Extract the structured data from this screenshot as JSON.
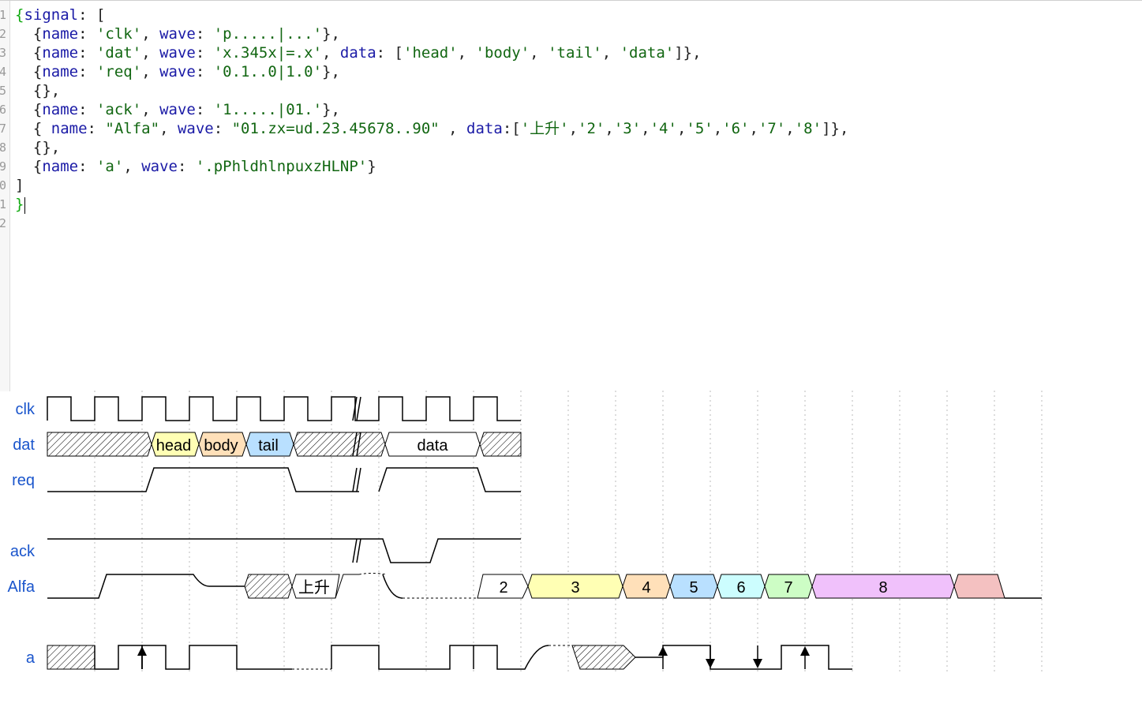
{
  "editor": {
    "line_numbers": [
      "1",
      "2",
      "3",
      "4",
      "5",
      "6",
      "7",
      "8",
      "9",
      "0",
      "1",
      "2"
    ],
    "code_lines": [
      [
        {
          "t": "{",
          "c": "br"
        },
        {
          "t": "signal",
          "c": "k"
        },
        {
          "t": ": [",
          "c": "p"
        }
      ],
      [
        {
          "t": "  {",
          "c": "p"
        },
        {
          "t": "name",
          "c": "k"
        },
        {
          "t": ": ",
          "c": "p"
        },
        {
          "t": "'clk'",
          "c": "s"
        },
        {
          "t": ", ",
          "c": "p"
        },
        {
          "t": "wave",
          "c": "k"
        },
        {
          "t": ": ",
          "c": "p"
        },
        {
          "t": "'p.....|...'",
          "c": "s"
        },
        {
          "t": "},",
          "c": "p"
        }
      ],
      [
        {
          "t": "  {",
          "c": "p"
        },
        {
          "t": "name",
          "c": "k"
        },
        {
          "t": ": ",
          "c": "p"
        },
        {
          "t": "'dat'",
          "c": "s"
        },
        {
          "t": ", ",
          "c": "p"
        },
        {
          "t": "wave",
          "c": "k"
        },
        {
          "t": ": ",
          "c": "p"
        },
        {
          "t": "'x.345x|=.x'",
          "c": "s"
        },
        {
          "t": ", ",
          "c": "p"
        },
        {
          "t": "data",
          "c": "k"
        },
        {
          "t": ": [",
          "c": "p"
        },
        {
          "t": "'head'",
          "c": "s"
        },
        {
          "t": ", ",
          "c": "p"
        },
        {
          "t": "'body'",
          "c": "s"
        },
        {
          "t": ", ",
          "c": "p"
        },
        {
          "t": "'tail'",
          "c": "s"
        },
        {
          "t": ", ",
          "c": "p"
        },
        {
          "t": "'data'",
          "c": "s"
        },
        {
          "t": "]},",
          "c": "p"
        }
      ],
      [
        {
          "t": "  {",
          "c": "p"
        },
        {
          "t": "name",
          "c": "k"
        },
        {
          "t": ": ",
          "c": "p"
        },
        {
          "t": "'req'",
          "c": "s"
        },
        {
          "t": ", ",
          "c": "p"
        },
        {
          "t": "wave",
          "c": "k"
        },
        {
          "t": ": ",
          "c": "p"
        },
        {
          "t": "'0.1..0|1.0'",
          "c": "s"
        },
        {
          "t": "},",
          "c": "p"
        }
      ],
      [
        {
          "t": "  {},",
          "c": "p"
        }
      ],
      [
        {
          "t": "  {",
          "c": "p"
        },
        {
          "t": "name",
          "c": "k"
        },
        {
          "t": ": ",
          "c": "p"
        },
        {
          "t": "'ack'",
          "c": "s"
        },
        {
          "t": ", ",
          "c": "p"
        },
        {
          "t": "wave",
          "c": "k"
        },
        {
          "t": ": ",
          "c": "p"
        },
        {
          "t": "'1.....|01.'",
          "c": "s"
        },
        {
          "t": "},",
          "c": "p"
        }
      ],
      [
        {
          "t": "  { ",
          "c": "p"
        },
        {
          "t": "name",
          "c": "k"
        },
        {
          "t": ": ",
          "c": "p"
        },
        {
          "t": "\"Alfa\"",
          "c": "s"
        },
        {
          "t": ", ",
          "c": "p"
        },
        {
          "t": "wave",
          "c": "k"
        },
        {
          "t": ": ",
          "c": "p"
        },
        {
          "t": "\"01.zx=ud.23.45678..90\"",
          "c": "s"
        },
        {
          "t": " , ",
          "c": "p"
        },
        {
          "t": "data",
          "c": "k"
        },
        {
          "t": ":[",
          "c": "p"
        },
        {
          "t": "'上升'",
          "c": "s"
        },
        {
          "t": ",",
          "c": "p"
        },
        {
          "t": "'2'",
          "c": "s"
        },
        {
          "t": ",",
          "c": "p"
        },
        {
          "t": "'3'",
          "c": "s"
        },
        {
          "t": ",",
          "c": "p"
        },
        {
          "t": "'4'",
          "c": "s"
        },
        {
          "t": ",",
          "c": "p"
        },
        {
          "t": "'5'",
          "c": "s"
        },
        {
          "t": ",",
          "c": "p"
        },
        {
          "t": "'6'",
          "c": "s"
        },
        {
          "t": ",",
          "c": "p"
        },
        {
          "t": "'7'",
          "c": "s"
        },
        {
          "t": ",",
          "c": "p"
        },
        {
          "t": "'8'",
          "c": "s"
        },
        {
          "t": "]},",
          "c": "p"
        }
      ],
      [
        {
          "t": "  {},",
          "c": "p"
        }
      ],
      [
        {
          "t": "  {",
          "c": "p"
        },
        {
          "t": "name",
          "c": "k"
        },
        {
          "t": ": ",
          "c": "p"
        },
        {
          "t": "'a'",
          "c": "s"
        },
        {
          "t": ", ",
          "c": "p"
        },
        {
          "t": "wave",
          "c": "k"
        },
        {
          "t": ": ",
          "c": "p"
        },
        {
          "t": "'.pPhldhlnpuxzHLNP'",
          "c": "s"
        },
        {
          "t": "}",
          "c": "p"
        }
      ],
      [
        {
          "t": "]",
          "c": "p"
        }
      ],
      [
        {
          "t": "}",
          "c": "br"
        }
      ],
      []
    ]
  },
  "waveform": {
    "signal_labels": {
      "clk": "clk",
      "dat": "dat",
      "req": "req",
      "ack": "ack",
      "alfa": "Alfa",
      "a": "a"
    },
    "dat_labels": {
      "head": "head",
      "body": "body",
      "tail": "tail",
      "data": "data"
    },
    "alfa_labels": {
      "rise": "上升",
      "d2": "2",
      "d3": "3",
      "d4": "4",
      "d5": "5",
      "d6": "6",
      "d7": "7",
      "d8": "8"
    },
    "colors": {
      "head": "#ffffb4",
      "body": "#ffe0b9",
      "tail": "#b9e0ff",
      "d3": "#ffffb4",
      "d4": "#ffe0b9",
      "d5": "#b9e0ff",
      "d6": "#ccfdfe",
      "d7": "#cdfdc5",
      "d8": "#f0c1fb",
      "d9": "#f4c1c1"
    }
  }
}
